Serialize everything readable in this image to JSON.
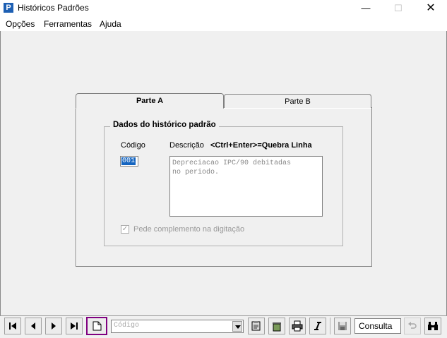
{
  "window": {
    "title": "Históricos Padrões"
  },
  "menu": [
    "Opções",
    "Ferramentas",
    "Ajuda"
  ],
  "tabs": [
    {
      "label": "Parte A"
    },
    {
      "label": "Parte B"
    }
  ],
  "group": {
    "title": "Dados do histórico padrão"
  },
  "fields": {
    "codigo_label": "Código",
    "descricao_label": "Descrição",
    "descricao_hint": "<Ctrl+Enter>=Quebra  Linha",
    "codigo_value": "001",
    "descricao_value": "Depreciacao IPC/90 debitadas\nno periodo."
  },
  "checkbox": {
    "label": "Pede complemento na digitação",
    "checked": true
  },
  "toolbar": {
    "search_placeholder": "Código",
    "mode_label": "Consulta"
  }
}
